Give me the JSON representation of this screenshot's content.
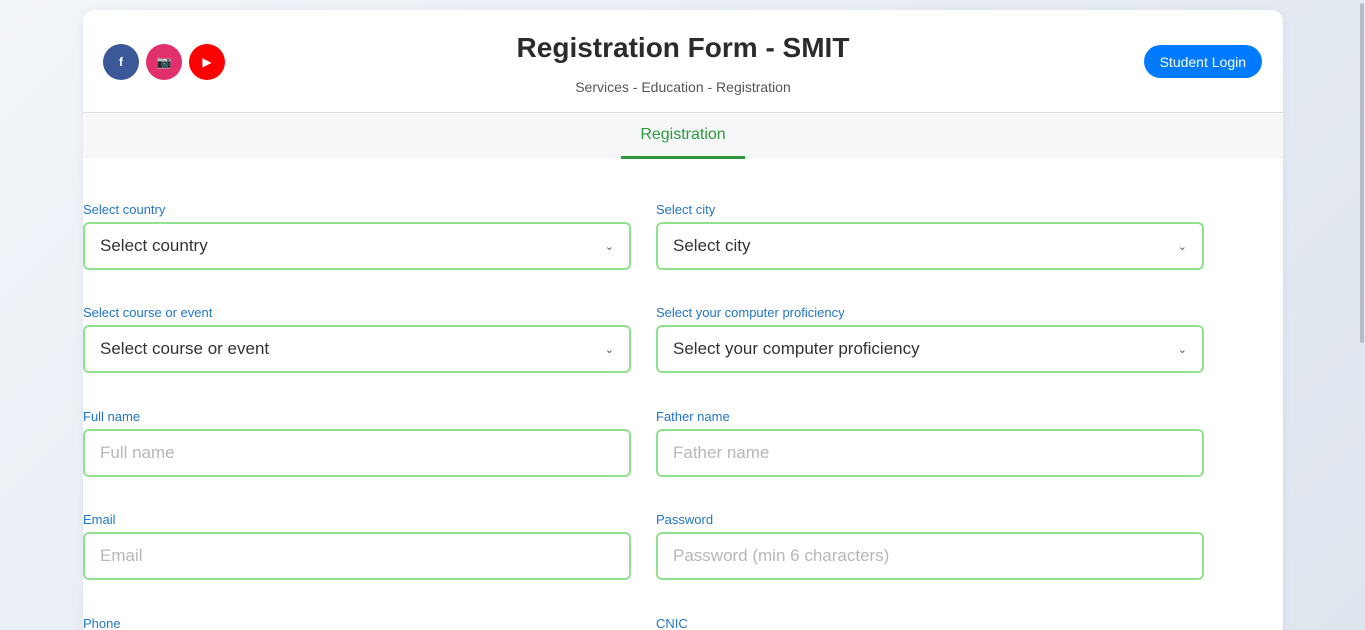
{
  "header": {
    "title": "Registration Form - SMIT",
    "breadcrumb": "Services - Education - Registration",
    "login_label": "Student Login",
    "socials": [
      {
        "label": "f",
        "icon": "facebook-icon",
        "color": "#3b5998"
      },
      {
        "label": "📷",
        "icon": "instagram-icon",
        "color": "#e1306c"
      },
      {
        "label": "▶",
        "icon": "youtube-icon",
        "color": "#ff0000"
      }
    ]
  },
  "tabs": {
    "active": "Registration"
  },
  "form": {
    "country": {
      "label": "Select country",
      "value": "Select country"
    },
    "city": {
      "label": "Select city",
      "value": "Select city"
    },
    "course": {
      "label": "Select course or event",
      "value": "Select course or event"
    },
    "proficiency": {
      "label": "Select your computer proficiency",
      "value": "Select your computer proficiency"
    },
    "full_name": {
      "label": "Full name",
      "placeholder": "Full name"
    },
    "father_name": {
      "label": "Father name",
      "placeholder": "Father name"
    },
    "email": {
      "label": "Email",
      "placeholder": "Email"
    },
    "password": {
      "label": "Password",
      "placeholder": "Password (min 6 characters)"
    },
    "phone": {
      "label": "Phone"
    },
    "cnic": {
      "label": "CNIC"
    }
  },
  "colors": {
    "accent_green": "#2c9a3d",
    "input_border": "#90e28e",
    "label_blue": "#2176c7",
    "login_blue": "#007bff"
  }
}
